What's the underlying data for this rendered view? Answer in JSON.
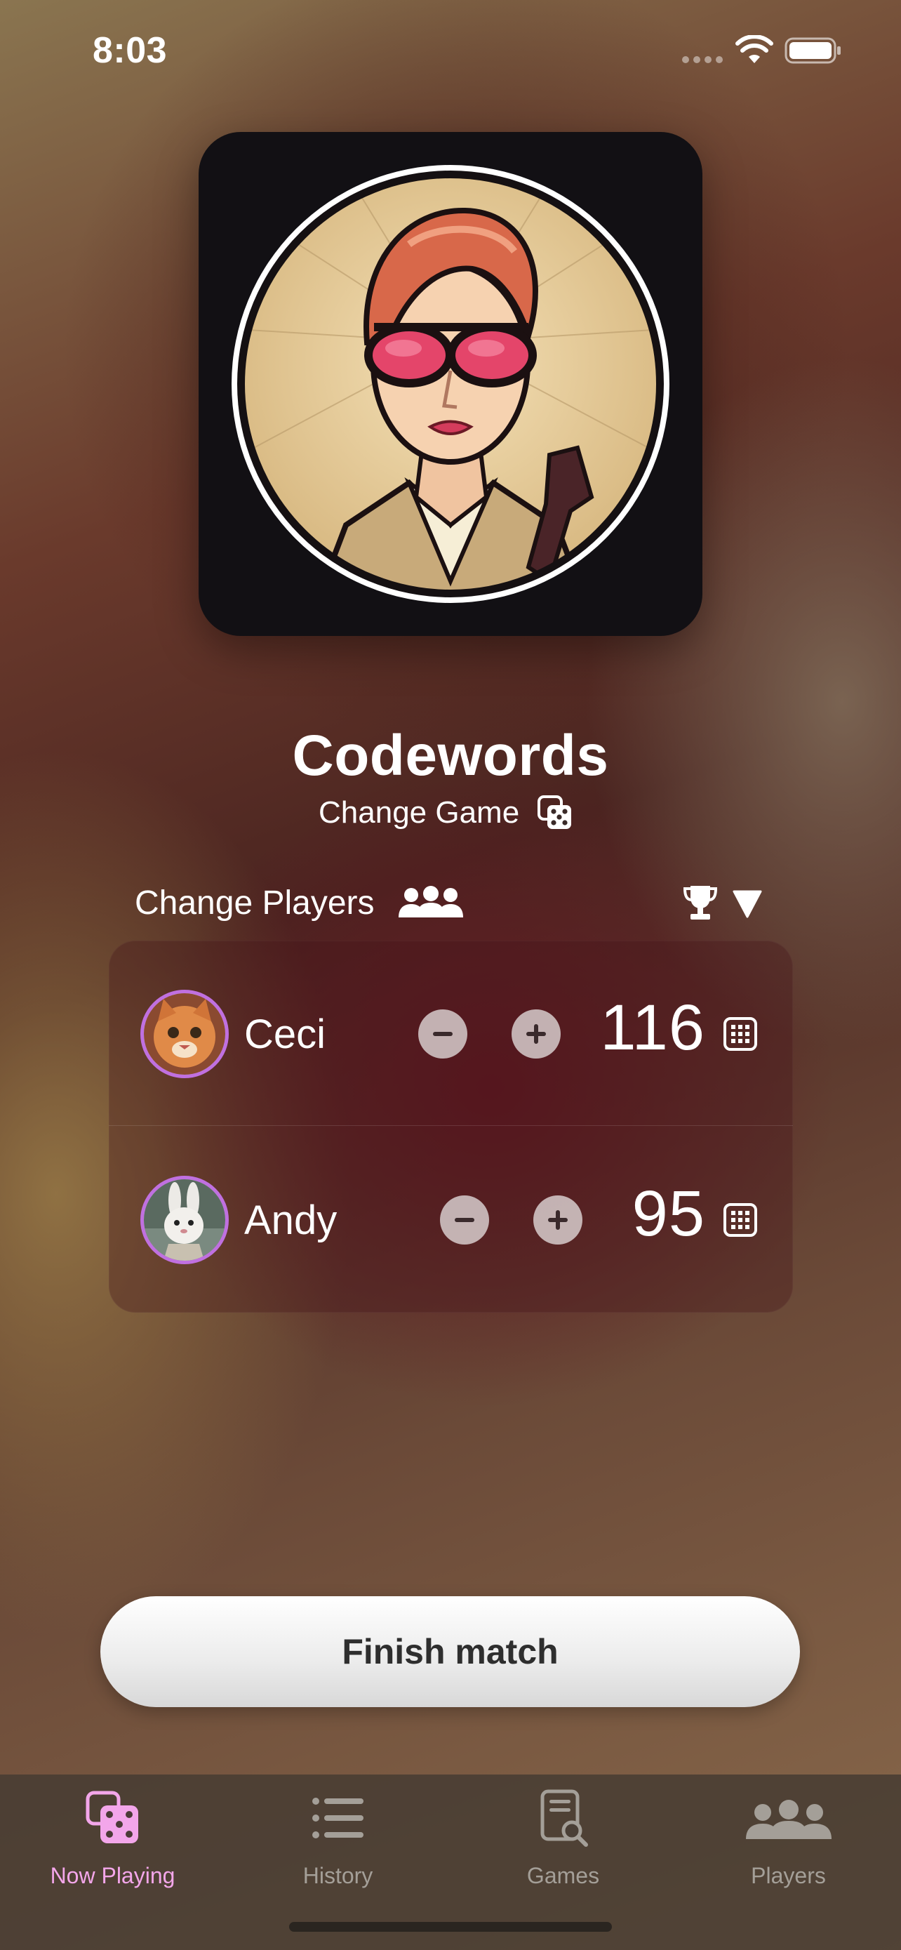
{
  "status_bar": {
    "time": "8:03"
  },
  "game": {
    "title": "Codewords",
    "change_label": "Change Game",
    "art_icon": "spy-woman-artwork"
  },
  "players_header": {
    "change_label": "Change Players",
    "players_icon": "people-icon",
    "trophy_icon": "trophy-icon",
    "sort_icon": "triangle-down-icon"
  },
  "players": [
    {
      "name": "Ceci",
      "score": "116",
      "avatar": "orange-cat-avatar"
    },
    {
      "name": "Andy",
      "score": "95",
      "avatar": "white-rabbit-avatar"
    }
  ],
  "finish_label": "Finish match",
  "tabs": [
    {
      "label": "Now Playing",
      "icon": "dice-icon",
      "active": true
    },
    {
      "label": "History",
      "icon": "list-icon",
      "active": false
    },
    {
      "label": "Games",
      "icon": "document-search-icon",
      "active": false
    },
    {
      "label": "Players",
      "icon": "people-icon",
      "active": false
    }
  ],
  "colors": {
    "accent_pink": "#f3a6ea",
    "avatar_ring": "#c070e0",
    "tab_inactive": "#a49f98"
  }
}
